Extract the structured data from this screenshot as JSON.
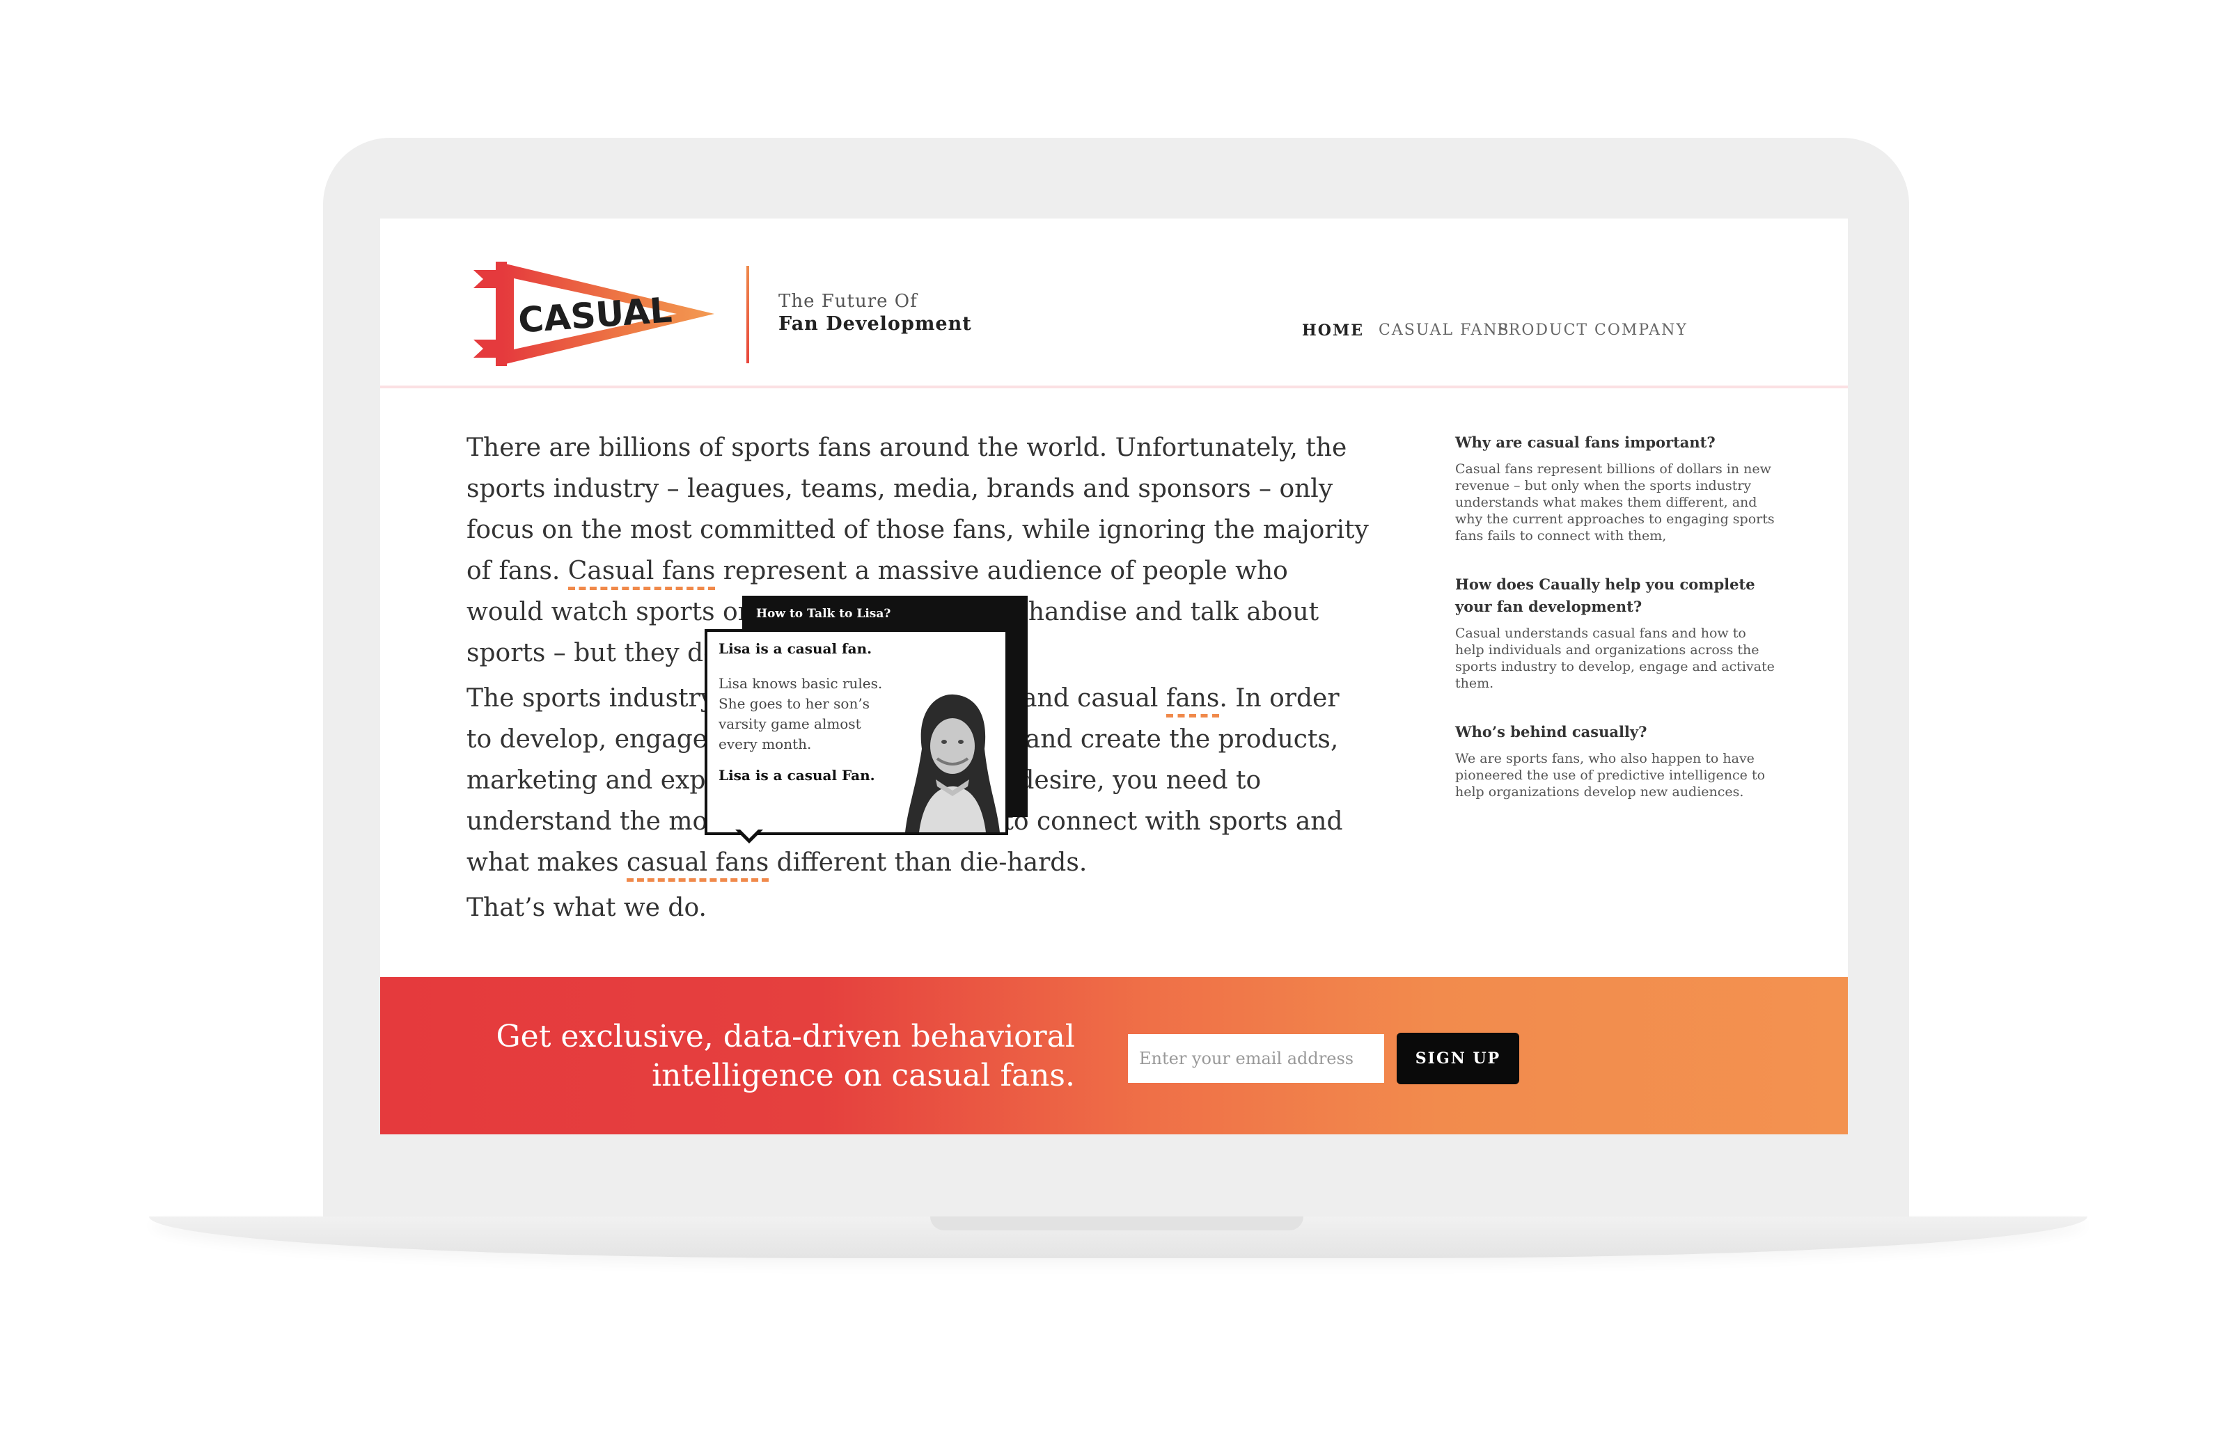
{
  "brand": {
    "logo_text": "CASUAL",
    "tagline_line1": "The Future Of",
    "tagline_line2": "Fan Development"
  },
  "nav": {
    "items": [
      {
        "label": "HOME",
        "active": true
      },
      {
        "label": "CASUAL FANS",
        "active": false
      },
      {
        "label": "PRODUCT",
        "active": false
      },
      {
        "label": "COMPANY",
        "active": false
      }
    ]
  },
  "main": {
    "p1_a": "There are billions of sports fans around the world.  Unfortunately, the sports industry – leagues, teams, media, brands and sponsors – only focus on the most committed of those fans, while ignoring the majority of fans.  ",
    "p1_link": "Casual fans",
    "p1_b": " represent a massive audience of people who would watch sports on TV, buy tickets, merchandise and talk about sports – but they don’t currently engage.",
    "p2_a": "The sports industry needs to better understand casual ",
    "p2_link": "fans",
    "p2_b": ".  In order to develop, engage and activate these fans, and create the products, marketing and experiences that these fans desire, you need to understand the motivations of individuals to connect with sports and what makes ",
    "p2_link2": "casual fans",
    "p2_c": " different than die-hards.",
    "p3": "That’s what we do."
  },
  "tooltip": {
    "title": "How to Talk to Lisa?",
    "heading": "Lisa is a casual fan.",
    "body": "Lisa knows basic rules. She goes to her son’s varsity game almost every month.",
    "footer": "Lisa is a casual Fan."
  },
  "sidebar": {
    "sections": [
      {
        "question": "Why are casual fans important?",
        "answer": "Casual fans represent billions of dollars in new revenue – but only when the sports industry understands what makes them different, and why the current approaches to engaging sports fans fails to connect with them,"
      },
      {
        "question": "How does Caually help you complete your fan development?",
        "answer": "Casual understands casual fans and how to help individuals and organizations across the sports industry to develop, engage and activate them."
      },
      {
        "question": "Who’s behind casually?",
        "answer": "We are sports fans, who also happen to have pioneered the use of predictive intelligence to help organizations develop new audiences."
      }
    ]
  },
  "cta": {
    "line1": "Get exclusive, data-driven behavioral",
    "line2": "intelligence on casual fans.",
    "email_placeholder": "Enter your email address",
    "button_label": "SIGN UP"
  },
  "colors": {
    "brand_red": "#e53a3d",
    "brand_orange": "#f39250",
    "underline_orange": "#f0894a",
    "dark": "#111111"
  }
}
